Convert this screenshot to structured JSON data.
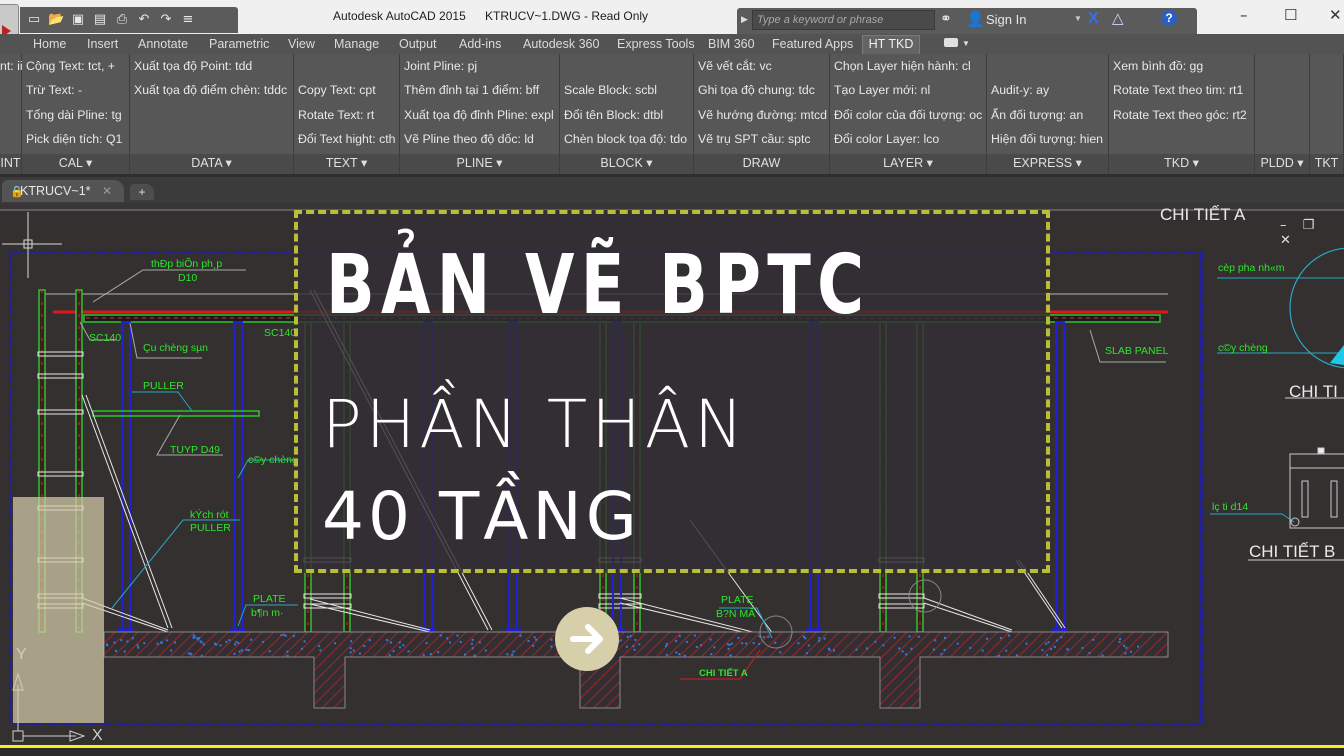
{
  "titlebar": {
    "app_title": "Autodesk AutoCAD 2015",
    "file_title": "KTRUCV~1.DWG - Read Only",
    "search_placeholder": "Type a keyword or phrase",
    "sign_in": "Sign In",
    "quick_access": [
      "new-icon",
      "open-icon",
      "save-icon",
      "saveas-icon",
      "print-icon",
      "undo-icon",
      "redo-icon",
      "customize-icon"
    ],
    "window_controls": {
      "minimize": "–",
      "maximize": "☐",
      "close": "✕"
    }
  },
  "ribbon_tabs": [
    "Home",
    "Insert",
    "Annotate",
    "Parametric",
    "View",
    "Manage",
    "Output",
    "Add-ins",
    "Autodesk 360",
    "Express Tools",
    "BIM 360",
    "Featured Apps",
    "HT TKD"
  ],
  "active_tab": "HT TKD",
  "panels": [
    {
      "title": "INT",
      "items": [
        "nt: ii",
        "",
        "",
        ""
      ]
    },
    {
      "title": "CAL",
      "items": [
        "Cộng Text: tct, +",
        "Trừ Text: -",
        "Tổng dài Pline: tg",
        "Pick diện tích: Q1"
      ]
    },
    {
      "title": "DATA",
      "items": [
        "Xuất tọa độ Point: tdd",
        "Xuất tọa độ điểm chèn: tddc",
        "",
        ""
      ]
    },
    {
      "title": "TEXT",
      "items": [
        "",
        "Copy Text: cpt",
        "Rotate Text: rt",
        "Đổi Text hight: cth"
      ]
    },
    {
      "title": "PLINE",
      "items": [
        "Joint Pline: pj",
        "Thêm đỉnh tại 1 điểm: bff",
        "Xuất tọa độ đỉnh Pline: expl",
        "Vẽ Pline theo độ dốc: ld"
      ]
    },
    {
      "title": "BLOCK",
      "items": [
        "",
        "Scale Block: scbl",
        "Đổi tên Block: dtbl",
        "Chèn block tọa độ: tdo"
      ]
    },
    {
      "title": "DRAW",
      "items": [
        "Vẽ vết cắt: vc",
        "Ghi tọa độ chung: tdc",
        "Vẽ hướng đường: mtcd",
        "Vẽ trụ SPT cầu: sptc"
      ]
    },
    {
      "title": "LAYER",
      "items": [
        "Chọn Layer hiện hành: cl",
        "Tạo Layer mới: nl",
        "Đổi color của đối tượng: oc",
        "Đổi color Layer: lco"
      ]
    },
    {
      "title": "EXPRESS",
      "items": [
        "",
        "Audit-y: ay",
        "Ẩn đối tượng: an",
        "Hiện đối tượng: hien"
      ]
    },
    {
      "title": "TKD",
      "items": [
        "Xem bình đồ: gg",
        "Rotate Text theo tim: rt1",
        "Rotate Text  theo góc: rt2",
        ""
      ]
    },
    {
      "title": "PLDD",
      "items": [
        "",
        "",
        "",
        ""
      ]
    },
    {
      "title": "TKT",
      "items": [
        "",
        "",
        "",
        ""
      ]
    }
  ],
  "file_tab": {
    "label": "KTRUCV~1*",
    "close": "✕",
    "new_tab": "+"
  },
  "banner": {
    "line1": "BẢN VẼ BPTC",
    "line2": "PHẦN THÂN",
    "line3": "40 TẦNG",
    "accent_color": "#b8bf36"
  },
  "drawing": {
    "titles": {
      "detail_a_top": "CHI TIẾT A",
      "detail_right": "CHI TI",
      "detail_b": "CHI TIẾT B"
    },
    "labels": {
      "thep_bien": "thÐp biÕn ph¸p",
      "d10": "D10",
      "sc140_left": "SC140",
      "sc140_right": "SC140",
      "cay_chong_sun": "Çu chèng sµn",
      "puller": "PULLER",
      "tuyp": "TUYP D49",
      "cay_chong": "c©y chèng",
      "kich_rut": "kÝch rót",
      "puller2": "PULLER",
      "plate": "PLATE",
      "ban_ma": "b¶n m·",
      "plate2": "PLATE",
      "ban_ma2": "B?N MÃ",
      "chi_tiet_a": "CHI TIẾT A",
      "slab_panel": "SLAB PANEL",
      "cop_pha": "cèp pha nh«m",
      "cay_chong_r": "c©y chèng",
      "lo_ti": "lç ti d14"
    },
    "ucs": {
      "x": "X",
      "y": "Y"
    },
    "viewport_controls": "– ❐ ✕"
  }
}
